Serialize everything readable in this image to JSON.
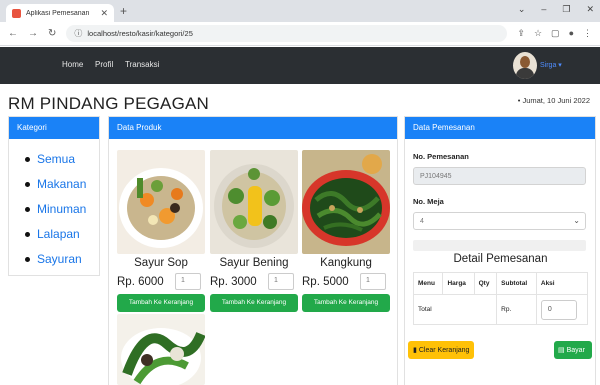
{
  "browser": {
    "tab_title": "Aplikasi Pemesanan",
    "url": "localhost/resto/kasir/kategori/25"
  },
  "navbar": {
    "links": [
      "Home",
      "Profil",
      "Transaksi"
    ],
    "username": "Sirga"
  },
  "header": {
    "shop_name": "RM PINDANG PEGAGAN",
    "date": "Jumat, 10 Juni 2022"
  },
  "kategori": {
    "title": "Kategori",
    "items": [
      "Semua",
      "Makanan",
      "Minuman",
      "Lalapan",
      "Sayuran"
    ]
  },
  "produk": {
    "title": "Data Produk",
    "add_label": "Tambah Ke Keranjang",
    "items": [
      {
        "name": "Sayur Sop",
        "price": "Rp. 6000",
        "qty": "1"
      },
      {
        "name": "Sayur Bening",
        "price": "Rp. 3000",
        "qty": "1"
      },
      {
        "name": "Kangkung",
        "price": "Rp. 5000",
        "qty": "1"
      }
    ]
  },
  "pemesanan": {
    "title": "Data Pemesanan",
    "no_label": "No. Pemesanan",
    "no_value": "PJ104945",
    "meja_label": "No. Meja",
    "meja_value": "4",
    "detail_title": "Detail Pemesanan",
    "columns": [
      "Menu",
      "Harga",
      "Qty",
      "Subtotal",
      "Aksi"
    ],
    "total_label": "Total",
    "total_currency": "Rp.",
    "total_value": "0",
    "clear_label": "Clear Keranjang",
    "pay_label": "Bayar"
  },
  "colors": {
    "primary": "#1a82f7",
    "success": "#22a94a",
    "warning": "#ffc107",
    "navbar": "#2b2f33"
  }
}
